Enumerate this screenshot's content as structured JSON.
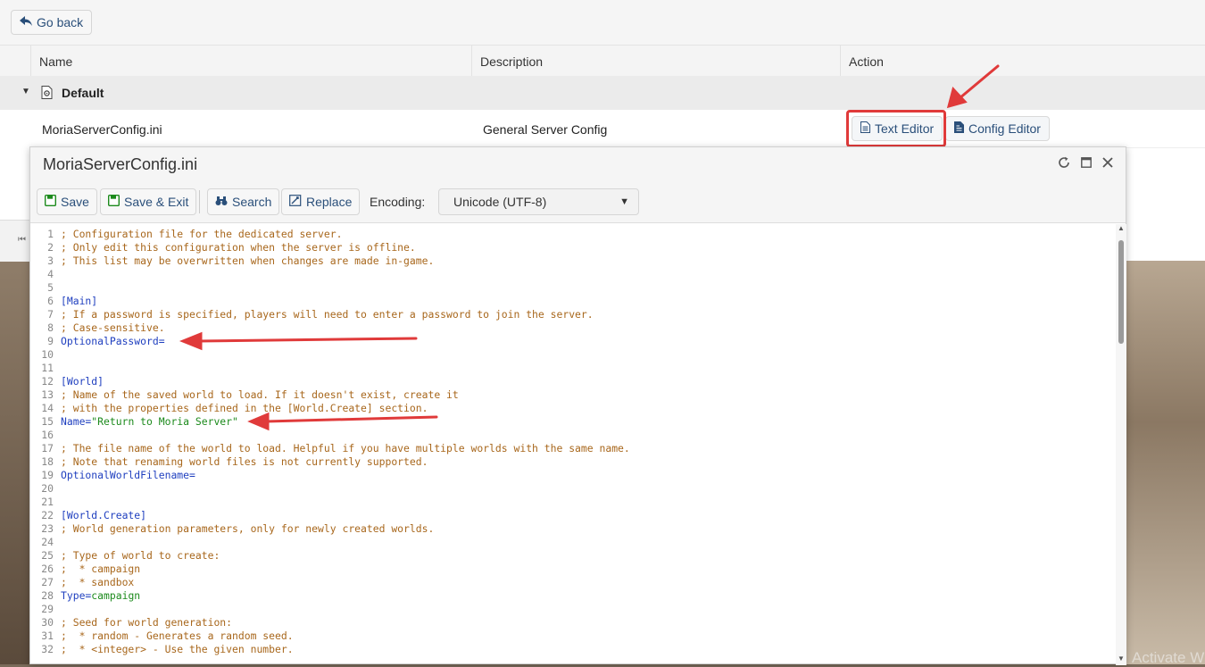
{
  "nav": {
    "go_back_label": "Go back"
  },
  "table": {
    "columns": [
      "Name",
      "Description",
      "Action"
    ],
    "group": {
      "label": "Default"
    },
    "row": {
      "name": "MoriaServerConfig.ini",
      "description": "General Server Config",
      "actions": [
        "Text Editor",
        "Config Editor"
      ]
    }
  },
  "editor": {
    "title": "MoriaServerConfig.ini",
    "toolbar": {
      "save": "Save",
      "save_exit": "Save & Exit",
      "search": "Search",
      "replace": "Replace",
      "encoding_label": "Encoding:",
      "encoding_value": "Unicode (UTF-8)"
    },
    "lines": [
      {
        "n": "1",
        "t": "; Configuration file for the dedicated server.",
        "k": "cmt"
      },
      {
        "n": "2",
        "t": "; Only edit this configuration when the server is offline.",
        "k": "cmt"
      },
      {
        "n": "3",
        "t": "; This list may be overwritten when changes are made in-game.",
        "k": "cmt"
      },
      {
        "n": "4",
        "t": "",
        "k": "cmt"
      },
      {
        "n": "5",
        "t": "",
        "k": "cmt"
      },
      {
        "n": "6",
        "t": "[Main]",
        "k": "sec"
      },
      {
        "n": "7",
        "t": "; If a password is specified, players will need to enter a password to join the server.",
        "k": "cmt"
      },
      {
        "n": "8",
        "t": "; Case-sensitive.",
        "k": "cmt"
      },
      {
        "n": "9",
        "t": "OptionalPassword=",
        "k": "key"
      },
      {
        "n": "10",
        "t": "",
        "k": "cmt"
      },
      {
        "n": "11",
        "t": "",
        "k": "cmt"
      },
      {
        "n": "12",
        "t": "[World]",
        "k": "sec"
      },
      {
        "n": "13",
        "t": "; Name of the saved world to load. If it doesn't exist, create it",
        "k": "cmt"
      },
      {
        "n": "14",
        "t": "; with the properties defined in the [World.Create] section.",
        "k": "cmt"
      },
      {
        "n": "15",
        "t": "Name=",
        "k": "key",
        "v": "\"Return to Moria Server\""
      },
      {
        "n": "16",
        "t": "",
        "k": "cmt"
      },
      {
        "n": "17",
        "t": "; The file name of the world to load. Helpful if you have multiple worlds with the same name.",
        "k": "cmt"
      },
      {
        "n": "18",
        "t": "; Note that renaming world files is not currently supported.",
        "k": "cmt"
      },
      {
        "n": "19",
        "t": "OptionalWorldFilename=",
        "k": "key"
      },
      {
        "n": "20",
        "t": "",
        "k": "cmt"
      },
      {
        "n": "21",
        "t": "",
        "k": "cmt"
      },
      {
        "n": "22",
        "t": "[World.Create]",
        "k": "sec"
      },
      {
        "n": "23",
        "t": "; World generation parameters, only for newly created worlds.",
        "k": "cmt"
      },
      {
        "n": "24",
        "t": "",
        "k": "cmt"
      },
      {
        "n": "25",
        "t": "; Type of world to create:",
        "k": "cmt"
      },
      {
        "n": "26",
        "t": ";  * campaign",
        "k": "cmt"
      },
      {
        "n": "27",
        "t": ";  * sandbox",
        "k": "cmt"
      },
      {
        "n": "28",
        "t": "Type=",
        "k": "key",
        "v": "campaign"
      },
      {
        "n": "29",
        "t": "",
        "k": "cmt"
      },
      {
        "n": "30",
        "t": "; Seed for world generation:",
        "k": "cmt"
      },
      {
        "n": "31",
        "t": ";  * random - Generates a random seed.",
        "k": "cmt"
      },
      {
        "n": "32",
        "t": ";  * <integer> - Use the given number.",
        "k": "cmt"
      }
    ]
  },
  "watermark": "Activate W",
  "colors": {
    "highlight": "#e03a3a",
    "link": "#2a4f7a",
    "comment": "#a8671c",
    "keyword": "#1f3fbf",
    "string": "#1c8a1c"
  }
}
